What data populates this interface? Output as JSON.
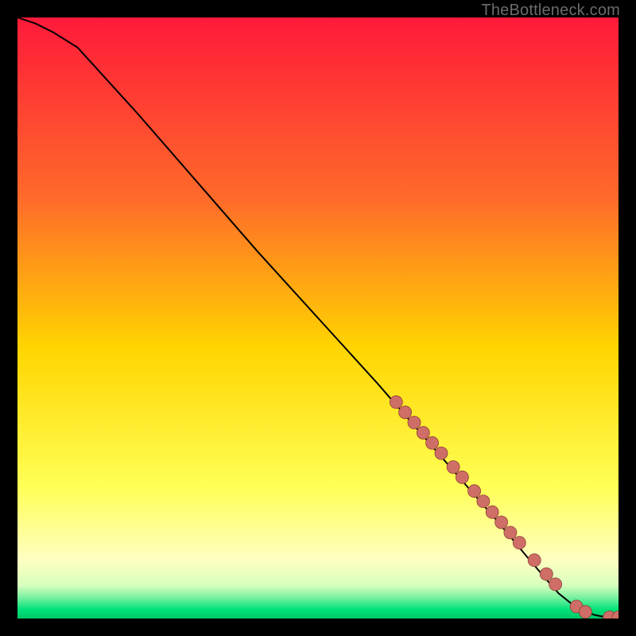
{
  "watermark": "TheBottleneck.com",
  "colors": {
    "top": "#ff1a3a",
    "mid": "#ffd500",
    "pale": "#ffffa8",
    "green": "#00e37a",
    "marker_fill": "#cf6e66",
    "marker_stroke": "#8f3e38",
    "curve": "#000000"
  },
  "chart_data": {
    "type": "line",
    "title": "",
    "xlabel": "",
    "ylabel": "",
    "xlim": [
      0,
      100
    ],
    "ylim": [
      0,
      100
    ],
    "curve": {
      "x": [
        0,
        3,
        6,
        10,
        20,
        30,
        40,
        50,
        60,
        70,
        80,
        85,
        88,
        90,
        92,
        94,
        96,
        98,
        100
      ],
      "y": [
        100,
        99,
        97.5,
        95,
        84,
        72.5,
        61,
        50,
        39,
        27.5,
        16,
        10,
        6.5,
        4.2,
        2.6,
        1.4,
        0.6,
        0.2,
        0.2
      ]
    },
    "markers": {
      "x": [
        63,
        64.5,
        66,
        67.5,
        69,
        70.5,
        72.5,
        74,
        76,
        77.5,
        79,
        80.5,
        82,
        83.5,
        86,
        88,
        89.5,
        93,
        94.5,
        98.5,
        100
      ],
      "y": [
        36,
        34.3,
        32.6,
        30.9,
        29.2,
        27.5,
        25.2,
        23.5,
        21.2,
        19.5,
        17.7,
        16,
        14.3,
        12.6,
        9.7,
        7.4,
        5.7,
        2.0,
        1.1,
        0.2,
        0.2
      ]
    },
    "gradient_stops": [
      {
        "offset": 0.0,
        "color": "#ff1a3a"
      },
      {
        "offset": 0.3,
        "color": "#ff6a2a"
      },
      {
        "offset": 0.55,
        "color": "#ffd500"
      },
      {
        "offset": 0.78,
        "color": "#ffff55"
      },
      {
        "offset": 0.9,
        "color": "#ffffc0"
      },
      {
        "offset": 0.945,
        "color": "#d8ffbe"
      },
      {
        "offset": 0.965,
        "color": "#7af0a0"
      },
      {
        "offset": 0.985,
        "color": "#00e37a"
      },
      {
        "offset": 1.0,
        "color": "#00c868"
      }
    ]
  }
}
